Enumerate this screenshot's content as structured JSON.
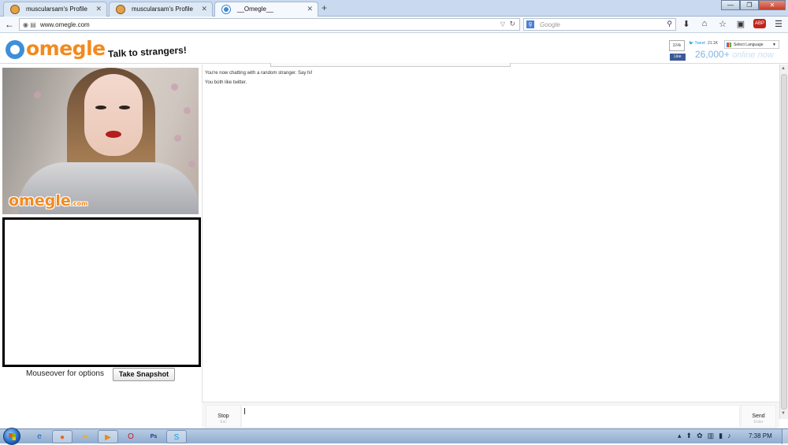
{
  "browser": {
    "tabs": [
      {
        "label": "muscularsam's Profile",
        "active": false
      },
      {
        "label": "muscularsam's Profile",
        "active": false
      },
      {
        "label": "__Omegle__",
        "active": true
      }
    ],
    "new_tab": "+",
    "url": "www.omegle.com",
    "search_placeholder": "Google",
    "search_engine_icon": "google-icon",
    "abp_label": "ABP"
  },
  "site": {
    "logo": "omegle",
    "tagline": "Talk to strangers!",
    "gplus_count": "324k",
    "fb_like": "Like",
    "tweet_label": "Tweet",
    "tweet_count": "21.1K",
    "language_label": "Select Language",
    "online_count": "26,000+",
    "online_label": "online now"
  },
  "video": {
    "watermark_main": "omegle",
    "watermark_suffix": ".com",
    "options_hint": "Mouseover for options",
    "snapshot_button": "Take Snapshot"
  },
  "chat": {
    "messages": [
      "You're now chatting with a random stranger. Say hi!",
      "You both like twitter."
    ],
    "input_value": "",
    "stop_label": "Stop",
    "stop_hint": "Esc",
    "send_label": "Send",
    "send_hint": "Enter"
  },
  "taskbar": {
    "apps": [
      "ie-icon",
      "firefox-icon",
      "explorer-icon",
      "media-player-icon",
      "opera-icon",
      "photoshop-icon",
      "skype-icon"
    ],
    "clock": "7:38 PM"
  },
  "colors": {
    "brand_orange": "#f28a1f",
    "brand_blue": "#3e8fd9",
    "online_blue": "#7fb4e6"
  }
}
